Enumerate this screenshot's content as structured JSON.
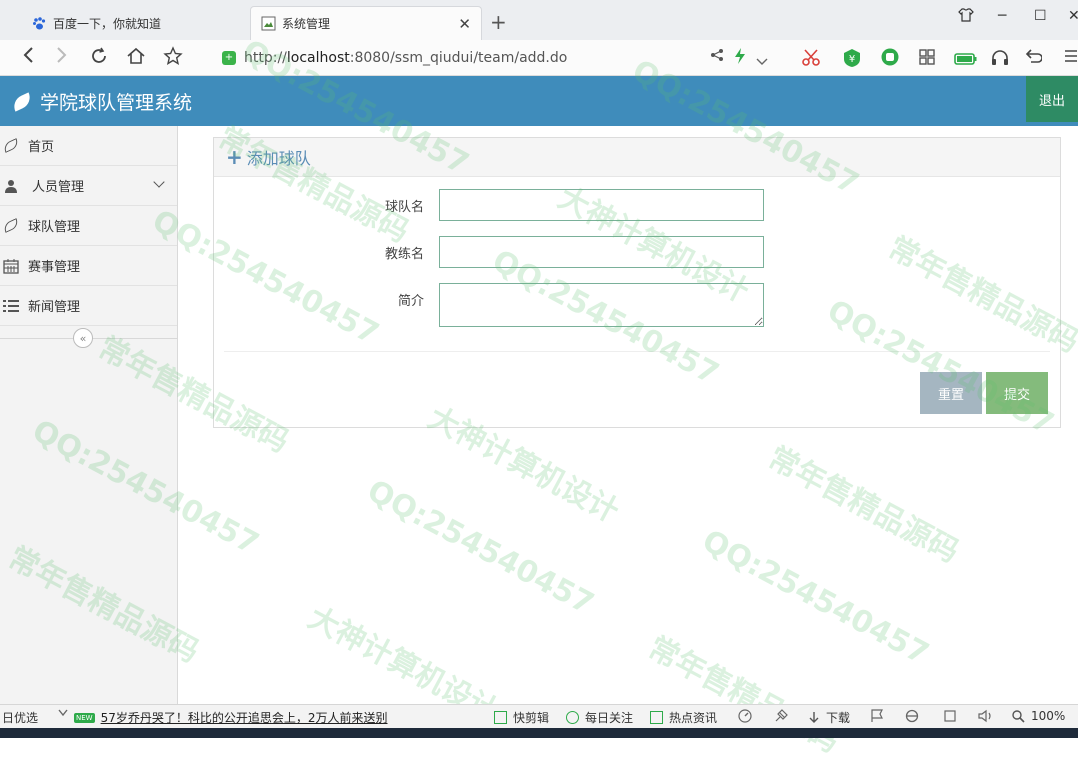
{
  "browser": {
    "tabs": [
      {
        "label": "百度一下，你就知道",
        "active": false
      },
      {
        "label": "系统管理",
        "active": true
      }
    ],
    "url": "http://localhost:8080/ssm_qiudui/team/add.do",
    "url_prefix": "http://",
    "url_host": "localhost",
    "url_rest": ":8080/ssm_qiudui/team/add.do"
  },
  "app": {
    "title": "学院球队管理系统",
    "logout_label": "退出",
    "header_color": "#3f8cbb"
  },
  "sidebar": {
    "items": [
      {
        "label": "首页",
        "icon": "leaf-icon"
      },
      {
        "label": "人员管理",
        "icon": "user-icon",
        "expandable": true
      },
      {
        "label": "球队管理",
        "icon": "leaf-icon"
      },
      {
        "label": "赛事管理",
        "icon": "calendar-icon"
      },
      {
        "label": "新闻管理",
        "icon": "list-icon"
      }
    ],
    "collapse_label": "«"
  },
  "form": {
    "title": "添加球队",
    "fields": [
      {
        "label": "球队名",
        "value": ""
      },
      {
        "label": "教练名",
        "value": ""
      },
      {
        "label": "简介",
        "value": ""
      }
    ],
    "reset_label": "重置",
    "submit_label": "提交"
  },
  "statusbar": {
    "left_label": "日优选",
    "news_badge": "NEW",
    "news_text": "57岁乔丹哭了！科比的公开追思会上，2万人前来送别",
    "kuaijianji": "快剪辑",
    "meiri": "每日关注",
    "redian": "热点资讯",
    "download": "下载",
    "zoom": "100%"
  },
  "watermarks": {
    "qq": "QQ:254540457",
    "a": "大神计算机设计",
    "b": "常年售精品源码"
  }
}
